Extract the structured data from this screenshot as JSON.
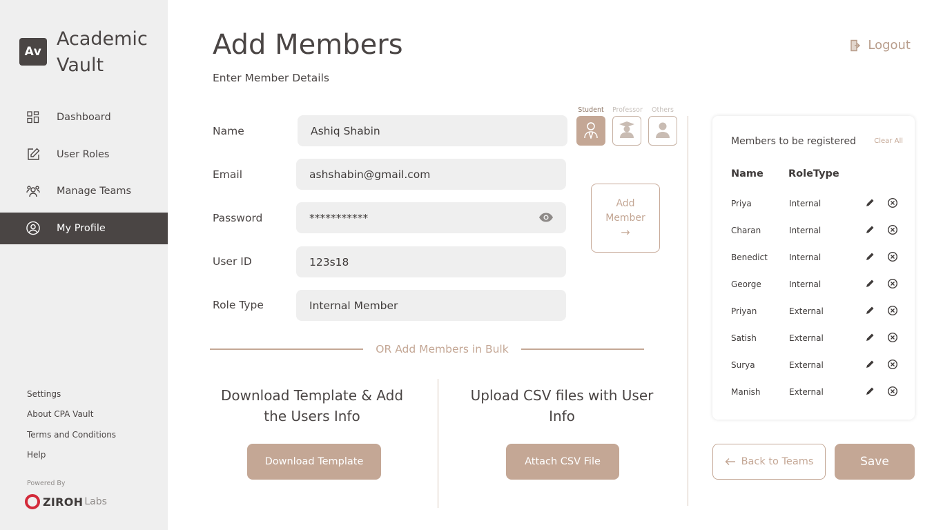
{
  "brand": {
    "logo_text": "Av",
    "name": "Academic Vault"
  },
  "nav": {
    "items": [
      {
        "label": "Dashboard",
        "icon": "grid-icon",
        "active": false
      },
      {
        "label": "User Roles",
        "icon": "edit-square-icon",
        "active": false
      },
      {
        "label": "Manage Teams",
        "icon": "team-icon",
        "active": false
      },
      {
        "label": "My Profile",
        "icon": "user-circle-icon",
        "active": true
      }
    ]
  },
  "footer": {
    "links": [
      "Settings",
      "About CPA Vault",
      "Terms and Conditions",
      "Help"
    ],
    "powered_by": "Powered By",
    "company": "ZIROH",
    "company_suffix": "Labs"
  },
  "header": {
    "title": "Add Members",
    "subtitle": "Enter Member Details",
    "logout_label": "Logout"
  },
  "form": {
    "name_label": "Name",
    "name_value": "Ashiq Shabin",
    "email_label": "Email",
    "email_value": "ashshabin@gmail.com",
    "password_label": "Password",
    "password_value": "***********",
    "userid_label": "User ID",
    "userid_value": "123s18",
    "roletype_label": "Role Type",
    "roletype_value": "Internal Member",
    "roles": [
      {
        "label": "Student",
        "active": true
      },
      {
        "label": "Professor",
        "active": false
      },
      {
        "label": "Others",
        "active": false
      }
    ],
    "add_member_line1": "Add",
    "add_member_line2": "Member",
    "add_member_arrow": "→"
  },
  "bulk": {
    "or_text": "OR Add Members in Bulk",
    "download_title": "Download Template & Add the Users Info",
    "download_button": "Download Template",
    "upload_title": "Upload CSV files with User Info",
    "upload_button": "Attach CSV File"
  },
  "members": {
    "title": "Members to be registered",
    "clear_all": "Clear All",
    "col_name": "Name",
    "col_role": "RoleType",
    "rows": [
      {
        "name": "Priya",
        "role": "Internal"
      },
      {
        "name": "Charan",
        "role": "Internal"
      },
      {
        "name": "Benedict",
        "role": "Internal"
      },
      {
        "name": "George",
        "role": "Internal"
      },
      {
        "name": "Priyan",
        "role": "External"
      },
      {
        "name": "Satish",
        "role": "External"
      },
      {
        "name": "Surya",
        "role": "External"
      },
      {
        "name": "Manish",
        "role": "External"
      }
    ]
  },
  "actions": {
    "back_label": "Back to Teams",
    "save_label": "Save"
  },
  "colors": {
    "accent": "#c4a795",
    "sidebar_bg": "#efefef",
    "sidebar_active": "#4a4544",
    "text_dark": "#4a4544"
  }
}
